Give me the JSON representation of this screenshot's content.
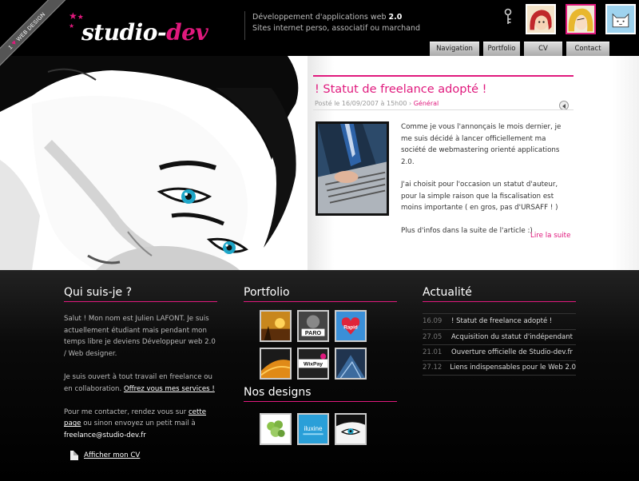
{
  "ribbon": {
    "heart": "♥",
    "text": "WEB DESIGN",
    "number": "1"
  },
  "logo": {
    "stars": "★",
    "part1": "studio-",
    "part2": "dev"
  },
  "tagline": {
    "line1_prefix": "Développement d'applications web ",
    "line1_bold": "2.0",
    "line2": "Sites internet perso, associatif ou marchand"
  },
  "nav": [
    "Navigation",
    "Portfolio",
    "CV",
    "Contact"
  ],
  "post": {
    "title": "! Statut de freelance adopté !",
    "meta_prefix": "Posté le 16/09/2007 à 15h00 › ",
    "category": "Général",
    "paragraphs": [
      "Comme je vous l'annonçais le mois dernier, je me suis décidé à lancer officiellement ma société de webmastering orienté applications 2.0.",
      "J'ai choisit pour l'occasion un statut d'auteur, pour la simple raison que la fiscalisation est moins importante ( en gros, pas d'URSAFF ! )",
      "Plus d'infos dans la suite de l'article :)"
    ],
    "more": "Lire la suite"
  },
  "about": {
    "title": "Qui suis-je ?",
    "p1": "Salut ! Mon nom est Julien LAFONT. Je suis actuellement étudiant mais pendant mon temps libre je deviens Développeur web 2.0 / Web designer.",
    "p2_text": "Je suis ouvert à tout travail en freelance ou en collaboration. ",
    "p2_link": "Offrez vous mes services !",
    "p3_prefix": "Pour me contacter, rendez vous sur ",
    "p3_link": "cette page",
    "p3_suffix": " ou sinon envoyez un petit mail à ",
    "email": "freelance@studio-dev.fr",
    "cv": "Afficher mon CV"
  },
  "portfolio": {
    "title": "Portfolio",
    "tile_labels": [
      "PARO",
      "Rapid",
      "WixPay"
    ],
    "designs_title": "Nos designs",
    "design_labels": [
      "iluxine"
    ]
  },
  "news": {
    "title": "Actualité",
    "items": [
      {
        "date": "16.09",
        "title": "! Statut de freelance adopté !"
      },
      {
        "date": "27.05",
        "title": "Acquisition du statut d'indépendant"
      },
      {
        "date": "21.01",
        "title": "Ouverture officielle de Studio-dev.fr"
      },
      {
        "date": "27.12",
        "title": "Liens indispensables pour le Web 2.0"
      }
    ]
  },
  "colors": {
    "accent": "#e0197d",
    "background": "#000000"
  }
}
